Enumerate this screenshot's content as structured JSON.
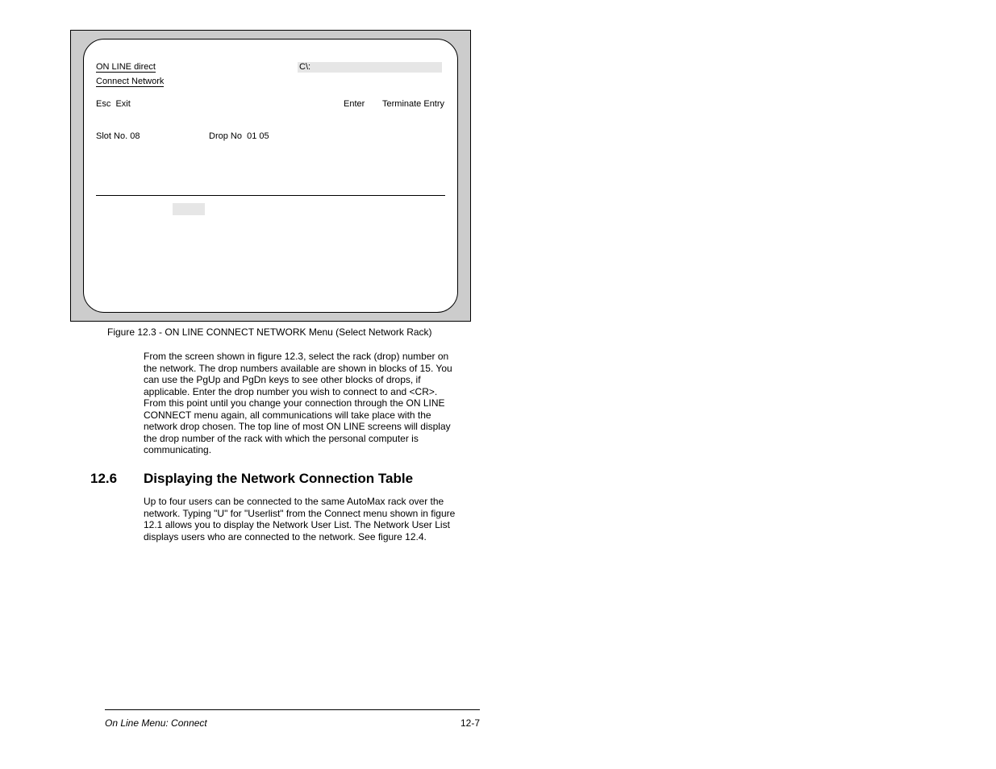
{
  "screen": {
    "line1_left": "ON LINE direct",
    "line1_path": "C\\:",
    "line2": "Connect Network",
    "esc": "Esc",
    "exit": "Exit",
    "enter": "Enter",
    "terminate": "Terminate Entry",
    "slot_label": "Slot No.",
    "slot_value": "08",
    "drop_label": "Drop No",
    "drop_values": "01 05"
  },
  "caption": "Figure 12.3 - ON LINE CONNECT NETWORK Menu (Select Network Rack)",
  "body1": "From the screen shown in figure 12.3, select the rack (drop) number on the network. The drop numbers available are shown in blocks of 15. You can use the PgUp and PgDn keys to see other blocks of drops, if applicable. Enter the drop number you wish to connect to and <CR>. From this point until you change your connection through the ON LINE CONNECT menu again, all communications will take place with the network drop chosen. The top line of most ON LINE screens will display the drop number of the rack with which the personal computer is communicating.",
  "section_num": "12.6",
  "section_title": "Displaying the Network Connection Table",
  "body2": "Up to four users can be connected to the same AutoMax rack over the network. Typing \"U\" for \"Userlist\" from the Connect menu shown in figure 12.1 allows you to display the Network User List. The Network User List displays users who are connected to the network. See figure 12.4.",
  "footer_text": "On Line Menu: Connect",
  "footer_page": "12-7"
}
